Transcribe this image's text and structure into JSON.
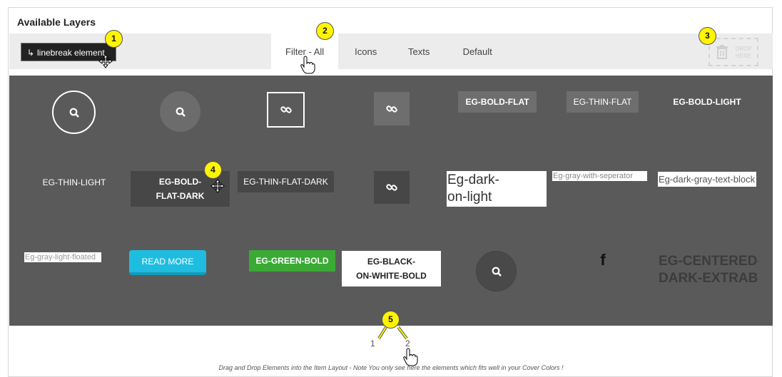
{
  "panel": {
    "title": "Available Layers"
  },
  "toolbar": {
    "linebreak_label": "linebreak element",
    "tabs": [
      {
        "label": "Filter - All",
        "active": true
      },
      {
        "label": "Icons",
        "active": false
      },
      {
        "label": "Texts",
        "active": false
      },
      {
        "label": "Default",
        "active": false
      }
    ],
    "drop_zone": {
      "label_line1": "DROP",
      "label_line2": "HERE",
      "icon": "trash-icon"
    }
  },
  "layers": [
    {
      "name": "search-circle-outline-icon",
      "icon": "search-icon"
    },
    {
      "name": "search-circle-filled-icon",
      "icon": "search-icon"
    },
    {
      "name": "link-square-outline-icon",
      "icon": "link-icon"
    },
    {
      "name": "link-square-filled-icon",
      "icon": "link-icon"
    },
    {
      "name": "eg-bold-flat",
      "label": "EG-BOLD-FLAT"
    },
    {
      "name": "eg-thin-flat",
      "label": "EG-THIN-FLAT"
    },
    {
      "name": "eg-bold-light",
      "label": "EG-BOLD-LIGHT"
    },
    {
      "name": "eg-thin-light",
      "label": "EG-THIN-LIGHT"
    },
    {
      "name": "eg-bold-flat-dark",
      "line1": "EG-BOLD-",
      "line2": "FLAT-DARK"
    },
    {
      "name": "eg-thin-flat-dark",
      "label": "EG-THIN-FLAT-DARK"
    },
    {
      "name": "link-square-dark-icon",
      "icon": "link-icon"
    },
    {
      "name": "eg-dark-on-light",
      "line1": "Eg-dark-",
      "line2": "on-light"
    },
    {
      "name": "eg-gray-with-seperator",
      "label": "Eg-gray-with-seperator"
    },
    {
      "name": "eg-dark-gray-text-block",
      "label": "Eg-dark-gray-text-block"
    },
    {
      "name": "eg-gray-light-floated",
      "label": "Eg-gray-light-floated"
    },
    {
      "name": "read-more-button",
      "label": "READ MORE"
    },
    {
      "name": "eg-green-bold",
      "label": "EG-GREEN-BOLD"
    },
    {
      "name": "eg-black-on-white-bold",
      "line1": "EG-BLACK-",
      "line2": "ON-WHITE-BOLD"
    },
    {
      "name": "search-circle-dark-icon",
      "icon": "search-icon"
    },
    {
      "name": "facebook-icon",
      "icon": "facebook-icon",
      "label": "f"
    },
    {
      "name": "eg-centered-dark-extrabold",
      "line1": "EG-CENTERED-",
      "line2": "DARK-EXTRABO"
    }
  ],
  "pagination": {
    "pages": [
      "1",
      "2"
    ]
  },
  "footer_note": "Drag and Drop Elements into the Item Layout - Note You only see here the elements which fits well in your Cover Colors !",
  "markers": [
    "1",
    "2",
    "3",
    "4",
    "5"
  ],
  "colors": {
    "layers_bg": "#5a5a5a",
    "read_more": "#1ebde0",
    "green_bold": "#3aaa35",
    "marker": "#fff500"
  }
}
